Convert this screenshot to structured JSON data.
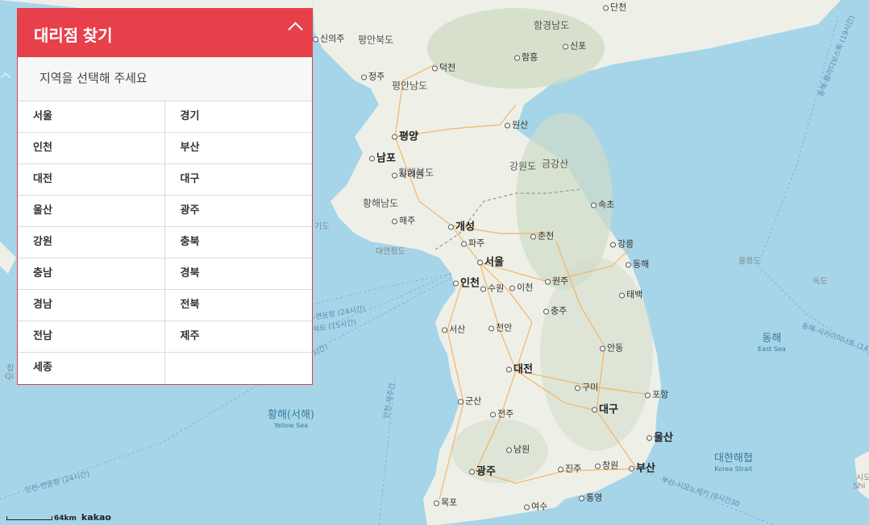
{
  "panel": {
    "title": "대리점 찾기",
    "prompt": "지역을 선택해 주세요",
    "regions": [
      "서울",
      "경기",
      "인천",
      "부산",
      "대전",
      "대구",
      "울산",
      "광주",
      "강원",
      "충북",
      "충남",
      "경북",
      "경남",
      "전북",
      "전남",
      "제주",
      "세종",
      ""
    ]
  },
  "map": {
    "scale_label": "64km",
    "provider": "kakao",
    "cities": [
      {
        "name": "단천",
        "big": false
      },
      {
        "name": "신의주",
        "big": false
      },
      {
        "name": "함흥",
        "big": false
      },
      {
        "name": "신포",
        "big": false
      },
      {
        "name": "덕천",
        "big": false
      },
      {
        "name": "정주",
        "big": false
      },
      {
        "name": "원산",
        "big": false
      },
      {
        "name": "평양",
        "big": true
      },
      {
        "name": "남포",
        "big": true
      },
      {
        "name": "사리원",
        "big": false
      },
      {
        "name": "해주",
        "big": false
      },
      {
        "name": "개성",
        "big": true
      },
      {
        "name": "속초",
        "big": false
      },
      {
        "name": "춘천",
        "big": false
      },
      {
        "name": "파주",
        "big": false
      },
      {
        "name": "강릉",
        "big": false
      },
      {
        "name": "서울",
        "big": true
      },
      {
        "name": "동해",
        "big": false
      },
      {
        "name": "인천",
        "big": true
      },
      {
        "name": "수원",
        "big": false
      },
      {
        "name": "이천",
        "big": false
      },
      {
        "name": "원주",
        "big": false
      },
      {
        "name": "태백",
        "big": false
      },
      {
        "name": "충주",
        "big": false
      },
      {
        "name": "서산",
        "big": false
      },
      {
        "name": "천안",
        "big": false
      },
      {
        "name": "안동",
        "big": false
      },
      {
        "name": "대전",
        "big": true
      },
      {
        "name": "구미",
        "big": false
      },
      {
        "name": "포항",
        "big": false
      },
      {
        "name": "군산",
        "big": false
      },
      {
        "name": "대구",
        "big": true
      },
      {
        "name": "전주",
        "big": false
      },
      {
        "name": "울산",
        "big": true
      },
      {
        "name": "남원",
        "big": false
      },
      {
        "name": "광주",
        "big": true
      },
      {
        "name": "진주",
        "big": false
      },
      {
        "name": "창원",
        "big": false
      },
      {
        "name": "부산",
        "big": true
      },
      {
        "name": "통영",
        "big": false
      },
      {
        "name": "목포",
        "big": false
      },
      {
        "name": "여수",
        "big": false
      }
    ],
    "regions": [
      "함경남도",
      "평안북도",
      "평안남도",
      "강원도",
      "금강산",
      "황해북도",
      "황해남도"
    ],
    "partial_region_labels": [
      "기도",
      "대연평도"
    ],
    "seas": [
      {
        "name": "황해(서해)",
        "sub": "Yellow Sea"
      },
      {
        "name": "동해",
        "sub": "East Sea"
      },
      {
        "name": "대한해협",
        "sub": "Korea Strait"
      }
    ],
    "islands": [
      "울릉도",
      "독도"
    ],
    "routes": [
      "동해-블라디보스톡 (19시간)",
      "동해-사카이미나토 (14",
      "-연운항 (24시간)",
      "석도 (15시간)",
      "시간)",
      "인천-제주간",
      "인천-연운항 (24시간)",
      "부산-시모노세키 (8시간30",
      "간)"
    ],
    "edge_labels": [
      "칭",
      "Qi",
      "시모",
      "Shi"
    ]
  }
}
